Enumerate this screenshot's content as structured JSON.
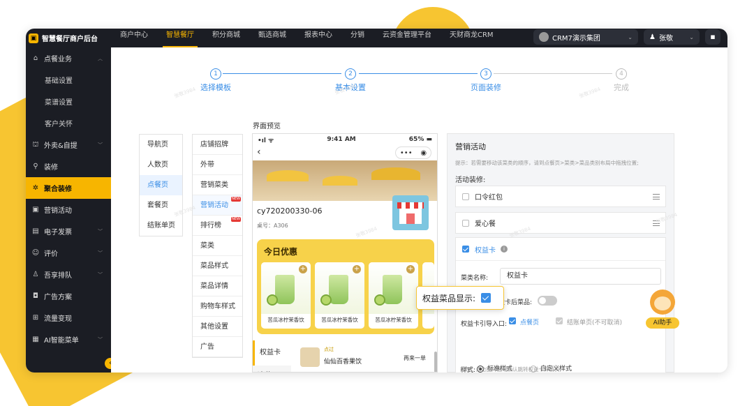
{
  "colors": {
    "accent": "#f7b500",
    "link": "#3a8ee6",
    "sidebar_bg": "#1b1d24"
  },
  "brand": "智慧餐厅商户后台",
  "top_nav": [
    "商户中心",
    "智慧餐厅",
    "积分商城",
    "甄选商城",
    "报表中心",
    "分销",
    "云资金管理平台",
    "天财商龙CRM"
  ],
  "top_right": {
    "org": "CRM7演示集团",
    "user": "张敬"
  },
  "sidebar": [
    {
      "label": "点餐业务",
      "icon": "home-icon",
      "arrow": true
    },
    {
      "label": "基础设置",
      "sub": true
    },
    {
      "label": "菜谱设置",
      "sub": true
    },
    {
      "label": "客户关怀",
      "sub": true
    },
    {
      "label": "外卖&自提",
      "icon": "bag-icon",
      "arrow": true
    },
    {
      "label": "装修",
      "icon": "brush-icon"
    },
    {
      "label": "聚合装修",
      "icon": "puzzle-icon",
      "active": true
    },
    {
      "label": "营销活动",
      "icon": "campaign-icon"
    },
    {
      "label": "电子发票",
      "icon": "invoice-icon",
      "arrow": true
    },
    {
      "label": "评价",
      "icon": "rating-icon",
      "arrow": true
    },
    {
      "label": "吾享排队",
      "icon": "queue-icon",
      "arrow": true
    },
    {
      "label": "广告方案",
      "icon": "ad-icon"
    },
    {
      "label": "流量变现",
      "icon": "traffic-icon"
    },
    {
      "label": "AI智能菜单",
      "icon": "ai-menu-icon",
      "arrow": true
    }
  ],
  "steps": [
    {
      "num": "1",
      "label": "选择模板",
      "done": true
    },
    {
      "num": "2",
      "label": "基本设置",
      "done": true
    },
    {
      "num": "3",
      "label": "页面装修",
      "done": true
    },
    {
      "num": "4",
      "label": "完成",
      "done": false
    }
  ],
  "preview_label": "界面预览",
  "pages": [
    "导航页",
    "人数页",
    "点餐页",
    "套餐页",
    "结账单页"
  ],
  "modules": [
    {
      "label": "店铺招牌"
    },
    {
      "label": "外带"
    },
    {
      "label": "营销菜类"
    },
    {
      "label": "营销活动",
      "new": true
    },
    {
      "label": "排行榜",
      "new": true
    },
    {
      "label": "菜类"
    },
    {
      "label": "菜品样式"
    },
    {
      "label": "菜品详情"
    },
    {
      "label": "购物车样式"
    },
    {
      "label": "其他设置"
    },
    {
      "label": "广告"
    }
  ],
  "new_badge": "NEW",
  "phone": {
    "signal": "•ıl ᯤ",
    "time": "9:41 AM",
    "battery": "65% ▬",
    "store_name": "cy720200330-06",
    "table": "桌号：A306",
    "promo_title": "今日优惠",
    "products": [
      "苦瓜冰柠茉香饮",
      "苦瓜冰柠茉香饮",
      "苦瓜冰柠茉香饮"
    ],
    "tab1": "权益卡",
    "tab2": "凉菜",
    "item_tag": "点过",
    "item_name": "仙仙百香果饮",
    "item_btn": "再来一单"
  },
  "panel": {
    "title": "营销活动",
    "hint": "提示：若需要移动该菜类的顺序，请到点餐页>菜类>菜品类别布局中拖拽位置;",
    "sub": "活动装修:",
    "items": [
      "口令红包",
      "爱心餐",
      "权益卡"
    ],
    "name_label": "菜类名称:",
    "name_value": "权益卡",
    "show_only_label": "仅显示购买权益卡后菜品:",
    "entry_label": "权益卡引导入口:",
    "entry_opt1": "点餐页",
    "entry_opt2": "结账单页(不可取消)",
    "style_label": "样式:",
    "style_opt1": "标准样式",
    "style_opt2": "自定义样式",
    "hint2": "提示：点击图片区域默认跳转权益卡详情页;"
  },
  "callout": "权益菜品显示:",
  "ai_label": "AI助手",
  "watermark": "张敬3984"
}
